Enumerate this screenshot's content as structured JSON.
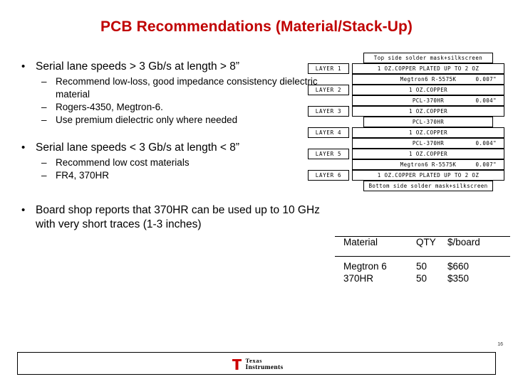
{
  "slide": {
    "title": "PCB Recommendations (Material/Stack-Up)",
    "page_number": "16",
    "title_color": "#c00000"
  },
  "bullets": [
    {
      "level1": "Serial lane speeds > 3 Gb/s at length > 8”",
      "marker": "•",
      "subs": [
        {
          "marker": "–",
          "text": "Recommend low-loss, good impedance consistency dielectric material"
        },
        {
          "marker": "–",
          "text": "Rogers-4350, Megtron-6."
        },
        {
          "marker": "–",
          "text": "Use premium dielectric only where needed"
        }
      ]
    },
    {
      "level1": "Serial lane speeds < 3 Gb/s at length < 8”",
      "marker": "•",
      "subs": [
        {
          "marker": "–",
          "text": "Recommend low cost materials"
        },
        {
          "marker": "–",
          "text": "FR4, 370HR"
        }
      ]
    },
    {
      "level1": "Board shop reports that 370HR can be used up to 10 GHz with very short traces (1-3 inches)",
      "marker": "•",
      "subs": []
    }
  ],
  "stackup": {
    "rows": [
      {
        "layer": "",
        "band": "Top side solder mask+silkscreen",
        "thickness": "",
        "inset": true
      },
      {
        "layer": "LAYER 1",
        "band": "1 OZ.COPPER PLATED UP TO 2 OZ",
        "thickness": "",
        "inset": false
      },
      {
        "layer": "",
        "band": "Megtron6 R-5575K",
        "thickness": "0.007\"",
        "inset": false
      },
      {
        "layer": "LAYER 2",
        "band": "1 OZ.COPPER",
        "thickness": "",
        "inset": false
      },
      {
        "layer": "",
        "band": "PCL-370HR",
        "thickness": "0.004\"",
        "inset": false
      },
      {
        "layer": "LAYER 3",
        "band": "1 OZ.COPPER",
        "thickness": "",
        "inset": false
      },
      {
        "layer": "",
        "band": "PCL-370HR",
        "thickness": "",
        "inset": true
      },
      {
        "layer": "LAYER 4",
        "band": "1 OZ.COPPER",
        "thickness": "",
        "inset": false
      },
      {
        "layer": "",
        "band": "PCL-370HR",
        "thickness": "0.004\"",
        "inset": false
      },
      {
        "layer": "LAYER 5",
        "band": "1 OZ.COPPER",
        "thickness": "",
        "inset": false
      },
      {
        "layer": "",
        "band": "Megtron6 R-5575K",
        "thickness": "0.007\"",
        "inset": false
      },
      {
        "layer": "LAYER 6",
        "band": "1 OZ.COPPER PLATED UP TO 2 OZ",
        "thickness": "",
        "inset": false
      },
      {
        "layer": "",
        "band": "Bottom side solder mask+silkscreen",
        "thickness": "",
        "inset": true
      }
    ]
  },
  "cost_table": {
    "headers": {
      "material": "Material",
      "qty": "QTY",
      "cost": "$/board"
    },
    "rows": [
      {
        "material": "Megtron 6",
        "qty": "50",
        "cost": "$660"
      },
      {
        "material": "370HR",
        "qty": "50",
        "cost": "$350"
      }
    ]
  },
  "footer": {
    "logo_line1": "Texas",
    "logo_line2": "Instruments"
  }
}
